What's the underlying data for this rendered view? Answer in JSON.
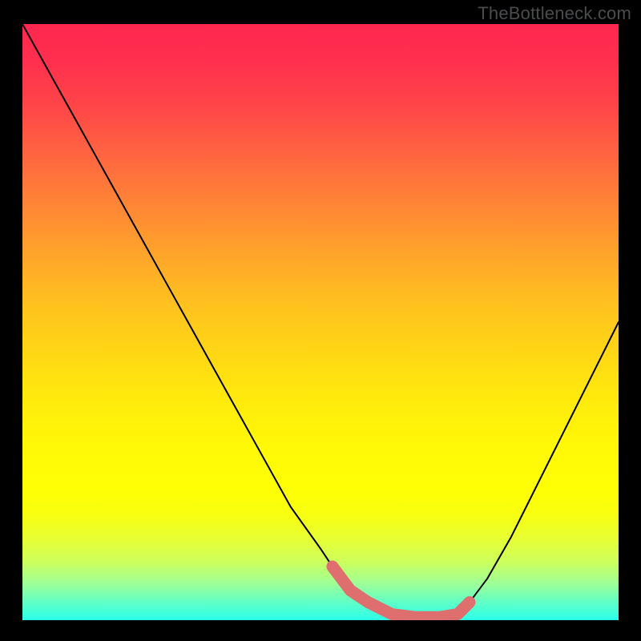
{
  "watermark": "TheBottleneck.com",
  "chart_data": {
    "type": "line",
    "title": "",
    "xlabel": "",
    "ylabel": "",
    "xlim": [
      0,
      100
    ],
    "ylim": [
      0,
      100
    ],
    "grid": false,
    "legend": false,
    "note": "Values estimated from pixel positions; chart has no tick labels so percentages are relative to plot extents.",
    "series": [
      {
        "name": "curve",
        "x": [
          0,
          5,
          10,
          15,
          20,
          25,
          30,
          35,
          40,
          45,
          50,
          52,
          55,
          58,
          62,
          66,
          70,
          73,
          75,
          78,
          82,
          86,
          90,
          94,
          98,
          100
        ],
        "y": [
          100,
          91,
          82,
          73,
          64,
          55,
          46,
          37,
          28,
          19,
          12,
          9,
          5,
          3,
          1.0,
          0.5,
          0.5,
          1.0,
          3,
          7,
          14,
          22,
          30,
          38,
          46,
          50
        ],
        "color": "#000000"
      },
      {
        "name": "highlight-band",
        "x": [
          52,
          55,
          58,
          62,
          66,
          70,
          73,
          75
        ],
        "y": [
          9,
          5,
          3,
          1.0,
          0.5,
          0.5,
          1.0,
          3
        ],
        "color": "#e06f6f",
        "stroke_width_px": 15
      }
    ],
    "background_gradient": {
      "direction": "top-to-bottom",
      "stops": [
        {
          "pos": 0,
          "color": "#ff264f"
        },
        {
          "pos": 14,
          "color": "#ff4648"
        },
        {
          "pos": 30,
          "color": "#ff8436"
        },
        {
          "pos": 46,
          "color": "#ffbe20"
        },
        {
          "pos": 62,
          "color": "#ffe80d"
        },
        {
          "pos": 78,
          "color": "#ffff04"
        },
        {
          "pos": 90,
          "color": "#cfff5a"
        },
        {
          "pos": 100,
          "color": "#2bffe9"
        }
      ]
    }
  }
}
